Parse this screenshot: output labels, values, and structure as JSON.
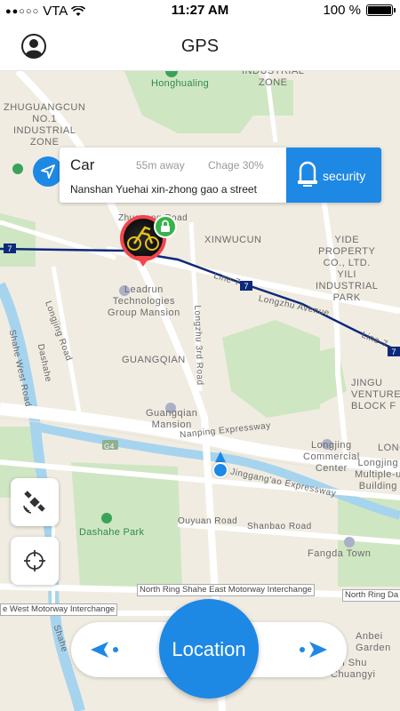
{
  "statusbar": {
    "carrier": "VTA",
    "time": "11:27 AM",
    "battery": "100 %"
  },
  "navbar": {
    "title": "GPS"
  },
  "info_card": {
    "name": "Car",
    "distance": "55m away",
    "charge": "Chage 30%",
    "address": "Nanshan Yuehai xin-zhong gao a street",
    "security_label": "security"
  },
  "map_labels": {
    "honghualing": "Honghualing",
    "industrial_zone": "INDUSTRIAL\nZONE",
    "zhuguangcun": "ZHUGUANGCUN\nNO.1\nINDUSTRIAL\nZONE",
    "zhuguang_road": "Zhuguang Road",
    "xinwucun": "XINWUCUN",
    "yide": "YIDE\nPROPERTY\nCO., LTD.\nYILI\nINDUSTRIAL\nPARK",
    "line7": "Line-7",
    "line7_badge": "7",
    "leadrun": "Leadrun\nTechnologies\nGroup Mansion",
    "longzhu_avenue": "Longzhu Avenue",
    "longjing_road": "Longjing Road",
    "longzhu_3rd": "Longzhu 3rd Road",
    "guangqian": "GUANGQIAN",
    "shahe_west": "Shahe West Road",
    "dashahe": "Dashahe",
    "guangqian_mansion": "Guangqian\nMansion",
    "nanping": "Nanping Expressway",
    "g4": "G4",
    "jingu": "JINGU\nVENTURE PA\nBLOCK F",
    "longjing_commercial": "Longjing\nCommercial\nCenter",
    "longjing_multiple": "Longjing\nMultiple-u\nBuilding",
    "long": "LONG",
    "jinggangao": "Jinggang'ao Expressway",
    "ouyuan": "Ouyuan Road",
    "shanbao": "Shanbao Road",
    "dashahe_park": "Dashahe Park",
    "fangda": "Fangda Town",
    "north_ring": "North Ring Shahe East Motorway Interchange",
    "north_ring_right": "North Ring Da",
    "west_motorway": "e West Motorway Interchange",
    "anbei": "Anbei\nGarden",
    "gpi": "gpi Shu\nChuangyi",
    "shahe_vertical": "Shahe"
  },
  "buttons": {
    "location": "Location"
  },
  "colors": {
    "accent": "#1e88e5",
    "marker": "#f0464c",
    "lock": "#36b34a",
    "line": "#0d2a7a"
  }
}
